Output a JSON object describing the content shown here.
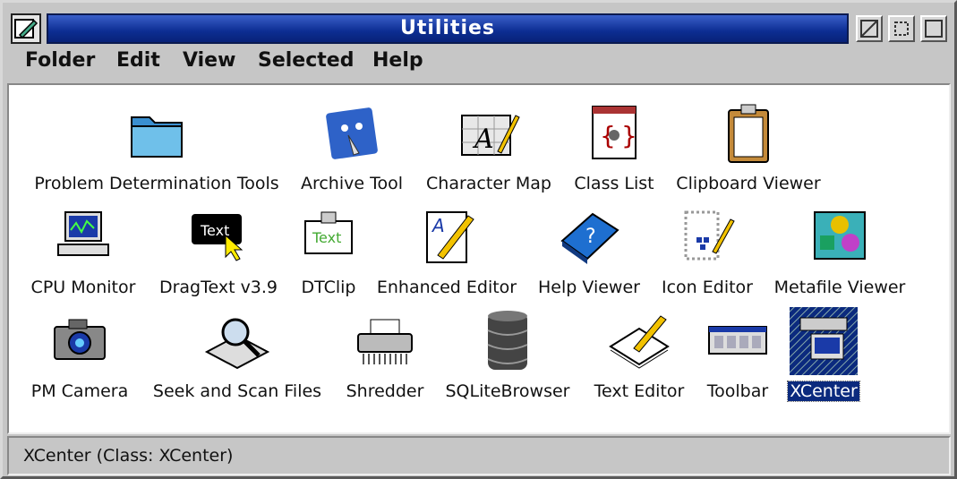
{
  "window": {
    "title": "Utilities"
  },
  "menubar": [
    "Folder",
    "Edit",
    "View",
    "Selected",
    "Help"
  ],
  "objects": [
    {
      "label": "Problem Determination Tools",
      "icon": "folder-icon"
    },
    {
      "label": "Archive Tool",
      "icon": "archive-icon"
    },
    {
      "label": "Character Map",
      "icon": "character-map-icon"
    },
    {
      "label": "Class List",
      "icon": "class-list-icon"
    },
    {
      "label": "Clipboard Viewer",
      "icon": "clipboard-icon"
    },
    {
      "label": "CPU Monitor",
      "icon": "cpu-monitor-icon"
    },
    {
      "label": "DragText v3.9",
      "icon": "dragtext-icon"
    },
    {
      "label": "DTClip",
      "icon": "dtclip-icon"
    },
    {
      "label": "Enhanced Editor",
      "icon": "editor-icon"
    },
    {
      "label": "Help Viewer",
      "icon": "help-book-icon"
    },
    {
      "label": "Icon Editor",
      "icon": "icon-editor-icon"
    },
    {
      "label": "Metafile Viewer",
      "icon": "metafile-icon"
    },
    {
      "label": "PM Camera",
      "icon": "camera-icon"
    },
    {
      "label": "Seek and Scan Files",
      "icon": "search-icon"
    },
    {
      "label": "Shredder",
      "icon": "shredder-icon"
    },
    {
      "label": "SQLiteBrowser",
      "icon": "database-icon"
    },
    {
      "label": "Text Editor",
      "icon": "text-editor-icon"
    },
    {
      "label": "Toolbar",
      "icon": "toolbar-icon"
    },
    {
      "label": "XCenter",
      "icon": "xcenter-icon",
      "selected": true
    }
  ],
  "status": {
    "text": "XCenter (Class: XCenter)"
  }
}
